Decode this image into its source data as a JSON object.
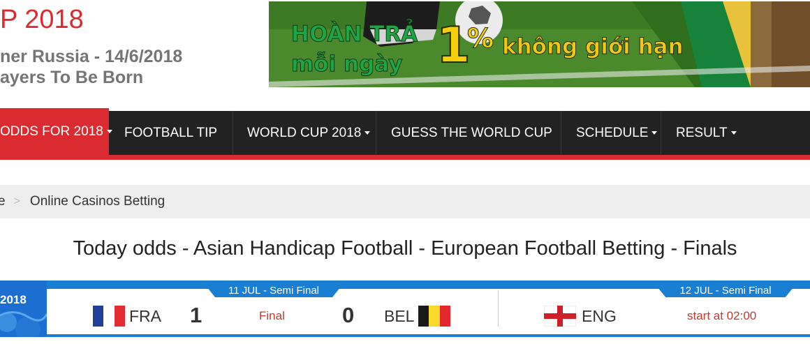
{
  "header": {
    "title": "P 2018",
    "subtitle_line1": "ner Russia - 14/6/2018",
    "subtitle_line2": "ayers To Be Born"
  },
  "banner": {
    "line1": "HOÀN TRẢ",
    "line2": "mỗi ngày",
    "big_number": "1",
    "percent": "%",
    "tagline": "không giới hạn"
  },
  "nav": {
    "items": [
      {
        "label": "ODDS FOR 2018",
        "dropdown": true,
        "active": true
      },
      {
        "label": "FOOTBALL TIP",
        "dropdown": false
      },
      {
        "label": "WORLD CUP 2018",
        "dropdown": true
      },
      {
        "label": "GUESS THE WORLD CUP",
        "dropdown": false
      },
      {
        "label": "SCHEDULE",
        "dropdown": true
      },
      {
        "label": "RESULT",
        "dropdown": true
      }
    ]
  },
  "breadcrumb": {
    "items": [
      "e",
      "Online Casinos Betting"
    ],
    "separator": ">"
  },
  "page": {
    "title": "Today odds - Asian Handicap Football - European Football Betting - Finals"
  },
  "scores": {
    "logo_text": "2018",
    "matches": [
      {
        "round": "11 JUL - Semi Final",
        "home": "FRA",
        "home_score": "1",
        "status": "Final",
        "away_score": "0",
        "away": "BEL"
      },
      {
        "round": "12 JUL - Semi Final",
        "home": "ENG",
        "status": "start at 02:00"
      }
    ]
  },
  "colors": {
    "brand_red": "#d92b30",
    "nav_bg": "#222222",
    "score_blue": "#1a7fd3"
  }
}
